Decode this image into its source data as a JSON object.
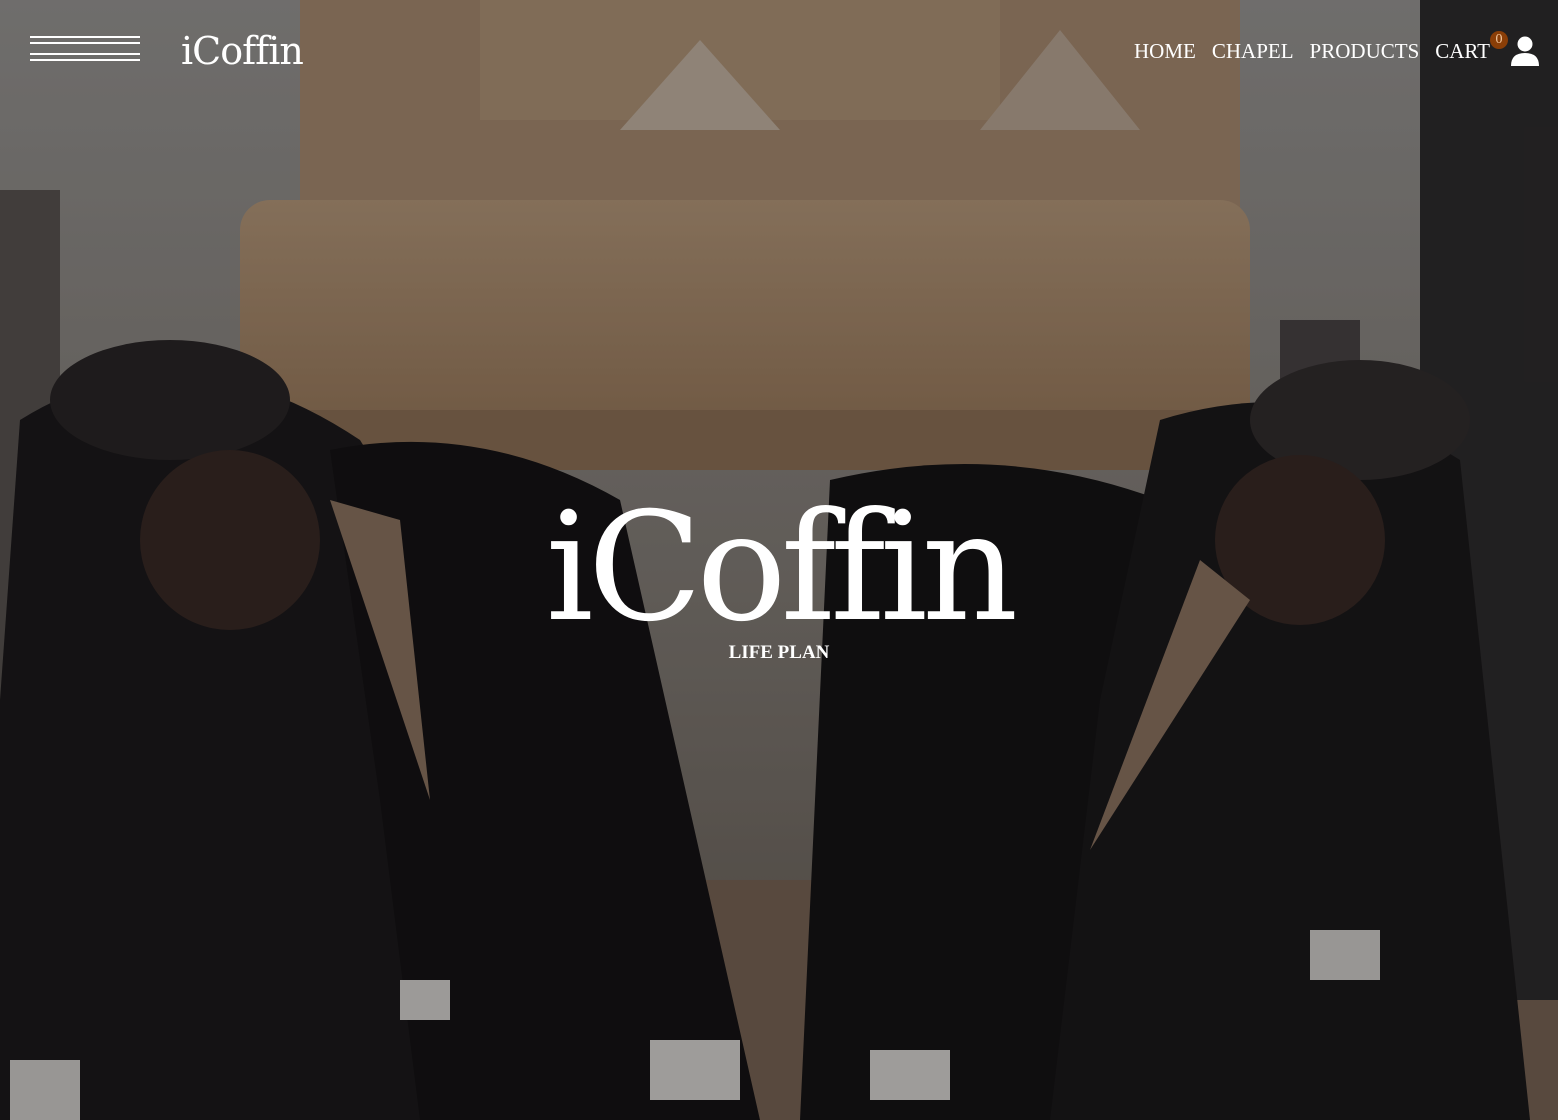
{
  "nav": {
    "brand": "iCoffin",
    "items": [
      {
        "label": "HOME"
      },
      {
        "label": "CHAPEL"
      },
      {
        "label": "PRODUCTS"
      }
    ],
    "cart_label": "CART",
    "cart_count": "0"
  },
  "hero": {
    "title": "iCoffin",
    "subtitle": "LIFE PLAN"
  },
  "colors": {
    "text": "#ffffff",
    "badge_bg": "#8a3e07",
    "badge_text": "#f3c79e"
  },
  "icons": {
    "menu": "hamburger-icon",
    "user": "user-icon"
  }
}
